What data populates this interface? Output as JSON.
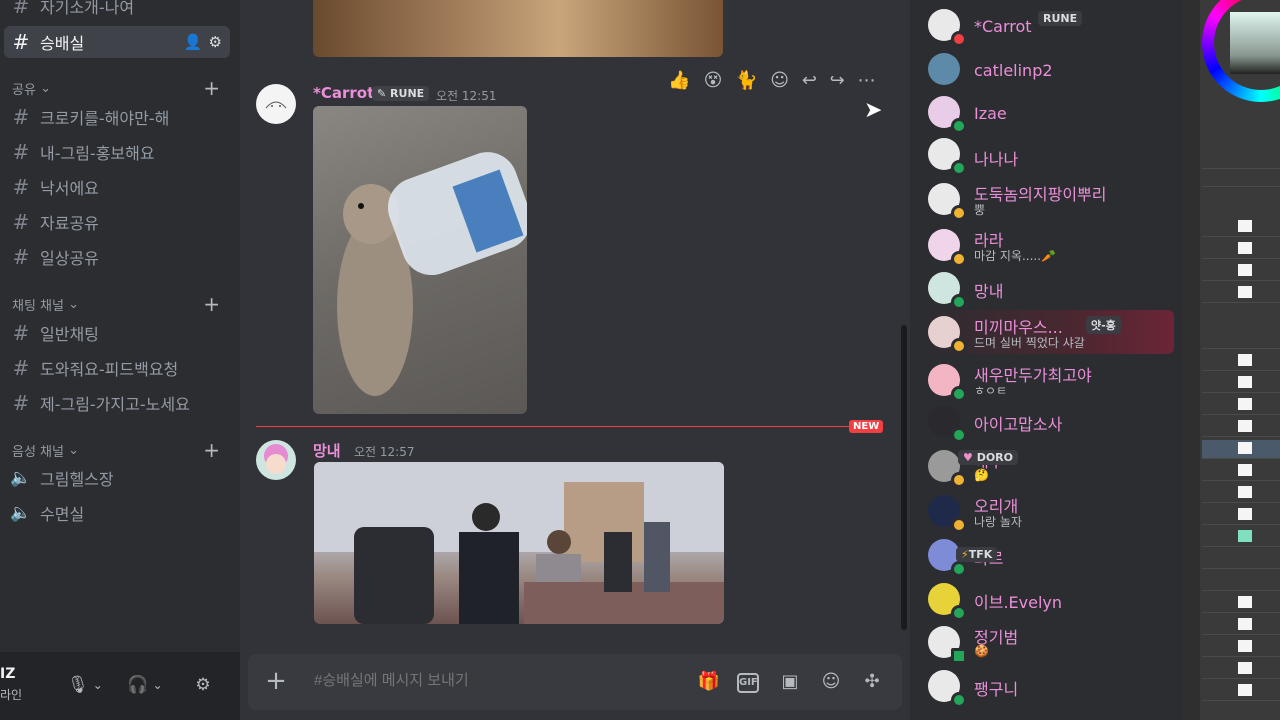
{
  "sidebar": {
    "top_channel": "자기소개-나여",
    "active_channel": "승배실",
    "categories": [
      {
        "name": "공유",
        "channels": [
          "크로키를-해야만-해",
          "내-그림-홍보해요",
          "낙서에요",
          "자료공유",
          "일상공유"
        ]
      },
      {
        "name": "채팅 채널",
        "channels": [
          "일반채팅",
          "도와줘요-피드백요청",
          "제-그림-가지고-노세요"
        ]
      },
      {
        "name": "음성 채널",
        "channels": [
          "그림헬스장",
          "수면실"
        ]
      }
    ],
    "user": {
      "name": "IZ",
      "status": "라인"
    }
  },
  "chat": {
    "messages": [
      {
        "author": "*Carrot",
        "tag": "RUNE",
        "time": "오전 12:51",
        "author_color": "#ea8fd8"
      },
      {
        "author": "망내",
        "time": "오전 12:57",
        "author_color": "#ea8fd8"
      }
    ],
    "new_label": "NEW",
    "composer_placeholder": "#승배실에 메시지 보내기",
    "composer_icons": [
      "gift-icon",
      "gif-icon",
      "sticker-icon",
      "emoji-icon",
      "apps-icon"
    ],
    "gif_label": "GIF"
  },
  "members": [
    {
      "name": "*Carrot",
      "tag": "RUNE",
      "status": "dnd"
    },
    {
      "name": "catlelinp2",
      "status": "none"
    },
    {
      "name": "Izae",
      "status": "online"
    },
    {
      "name": "나나나",
      "status": "online"
    },
    {
      "name": "도둑놈의지팡이뿌리",
      "sub": "뿡",
      "status": "idle"
    },
    {
      "name": "라라",
      "sub": "마감 지옥.....🥕",
      "status": "idle"
    },
    {
      "name": "망내",
      "status": "online"
    },
    {
      "name": "미끼마우스...",
      "tag": "얏-홍",
      "sub": "드며 실버 찍었다 샤갈",
      "status": "idle",
      "highlight": true
    },
    {
      "name": "새우만두가최고야",
      "sub": "ㅎㅇㅌ",
      "status": "online"
    },
    {
      "name": "아이고맙소사",
      "status": "online"
    },
    {
      "name": "애쿠",
      "tag": "DORO",
      "sub": "🤔",
      "status": "idle"
    },
    {
      "name": "오리개",
      "sub": "나랑 놀자",
      "status": "idle"
    },
    {
      "name": "와르",
      "tag": "TFK",
      "status": "online"
    },
    {
      "name": "이브.Evelyn",
      "status": "online"
    },
    {
      "name": "정기범",
      "sub": "🍪",
      "status": "mobile"
    },
    {
      "name": "팽구니",
      "status": "online"
    }
  ],
  "colors": {
    "online": "#23a55a",
    "idle": "#f0b232",
    "dnd": "#f23f43",
    "name": "#ea8fd8"
  }
}
